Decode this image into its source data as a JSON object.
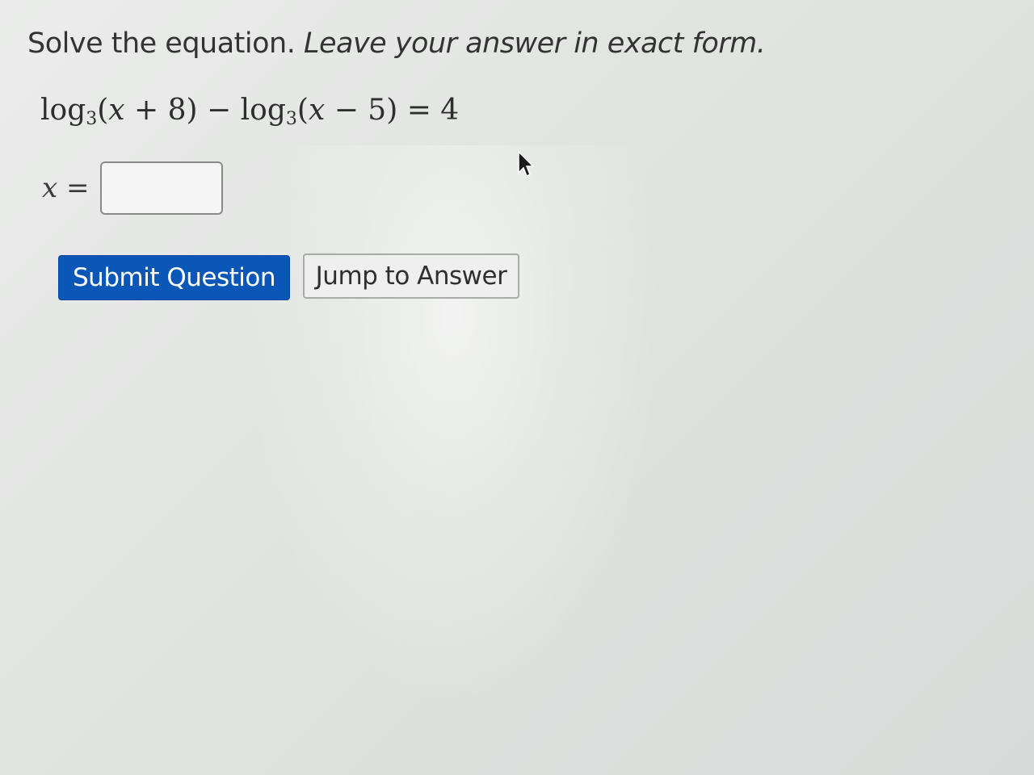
{
  "question": {
    "prefix": "Solve the equation.",
    "instruction": "Leave your answer in exact form."
  },
  "equation": {
    "log1": "log",
    "base1": "3",
    "open1": "(",
    "var1": "x",
    "op1": " + 8)",
    "minus": " − ",
    "log2": "log",
    "base2": "3",
    "open2": "(",
    "var2": "x",
    "op2": " − 5) = 4"
  },
  "answer": {
    "variable": "x",
    "equals": " =",
    "value": "",
    "placeholder": ""
  },
  "buttons": {
    "submit_label": "Submit Question",
    "jump_label": "Jump to Answer"
  },
  "colors": {
    "submit_bg": "#0a57b8",
    "submit_text": "#ffffff"
  },
  "icons": {
    "cursor": "mouse-pointer-icon"
  }
}
